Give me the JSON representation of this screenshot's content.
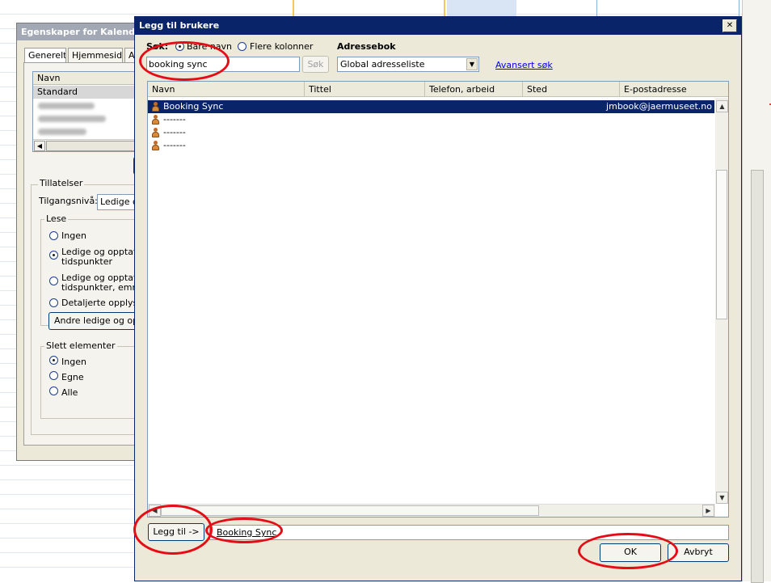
{
  "background_dialog": {
    "title": "Egenskaper for Kalender",
    "tabs": [
      "Generelt",
      "Hjemmeside",
      "A"
    ],
    "permissions_list": {
      "header": "Navn",
      "selected_item": "Standard"
    },
    "permissions_group": "Tillatelser",
    "access_level_label": "Tilgangsnivå:",
    "access_level_value": "Ledige og",
    "read_group": "Lese",
    "read_options": [
      "Ingen",
      "Ledige og opptatte\ntidspunkter",
      "Ledige og opptatte\ntidspunkter, emne,",
      "Detaljerte opplysni"
    ],
    "read_selected_index": 1,
    "other_button": "Andre ledige og oppt",
    "delete_group": "Slett elementer",
    "delete_options": [
      "Ingen",
      "Egne",
      "Alle"
    ],
    "delete_selected_index": 0
  },
  "dialog": {
    "title": "Legg til brukere",
    "close_icon": "close-icon",
    "search_label": "Søk:",
    "search_mode_options": [
      "Bare navn",
      "Flere kolonner"
    ],
    "search_mode_selected_index": 0,
    "search_value": "booking sync",
    "search_button": "Søk",
    "address_book_label": "Adressebok",
    "address_book_value": "Global adresseliste",
    "advanced_search_link": "Avansert søk",
    "columns": [
      "Navn",
      "Tittel",
      "Telefon, arbeid",
      "Sted",
      "E-postadresse"
    ],
    "rows": [
      {
        "name": "Booking Sync",
        "email": "jmbook@jaermuseet.no"
      },
      {
        "name": "-------",
        "email": ""
      },
      {
        "name": "-------",
        "email": ""
      },
      {
        "name": "-------",
        "email": ""
      }
    ],
    "selected_row_index": 0,
    "add_button": "Legg til ->",
    "selected_users_value": "Booking Sync",
    "ok_button": "OK",
    "cancel_button": "Avbryt"
  },
  "colors": {
    "title_bar": "#0a246a",
    "dialog_face": "#ece9d8",
    "annotation_red": "#e40d16"
  }
}
